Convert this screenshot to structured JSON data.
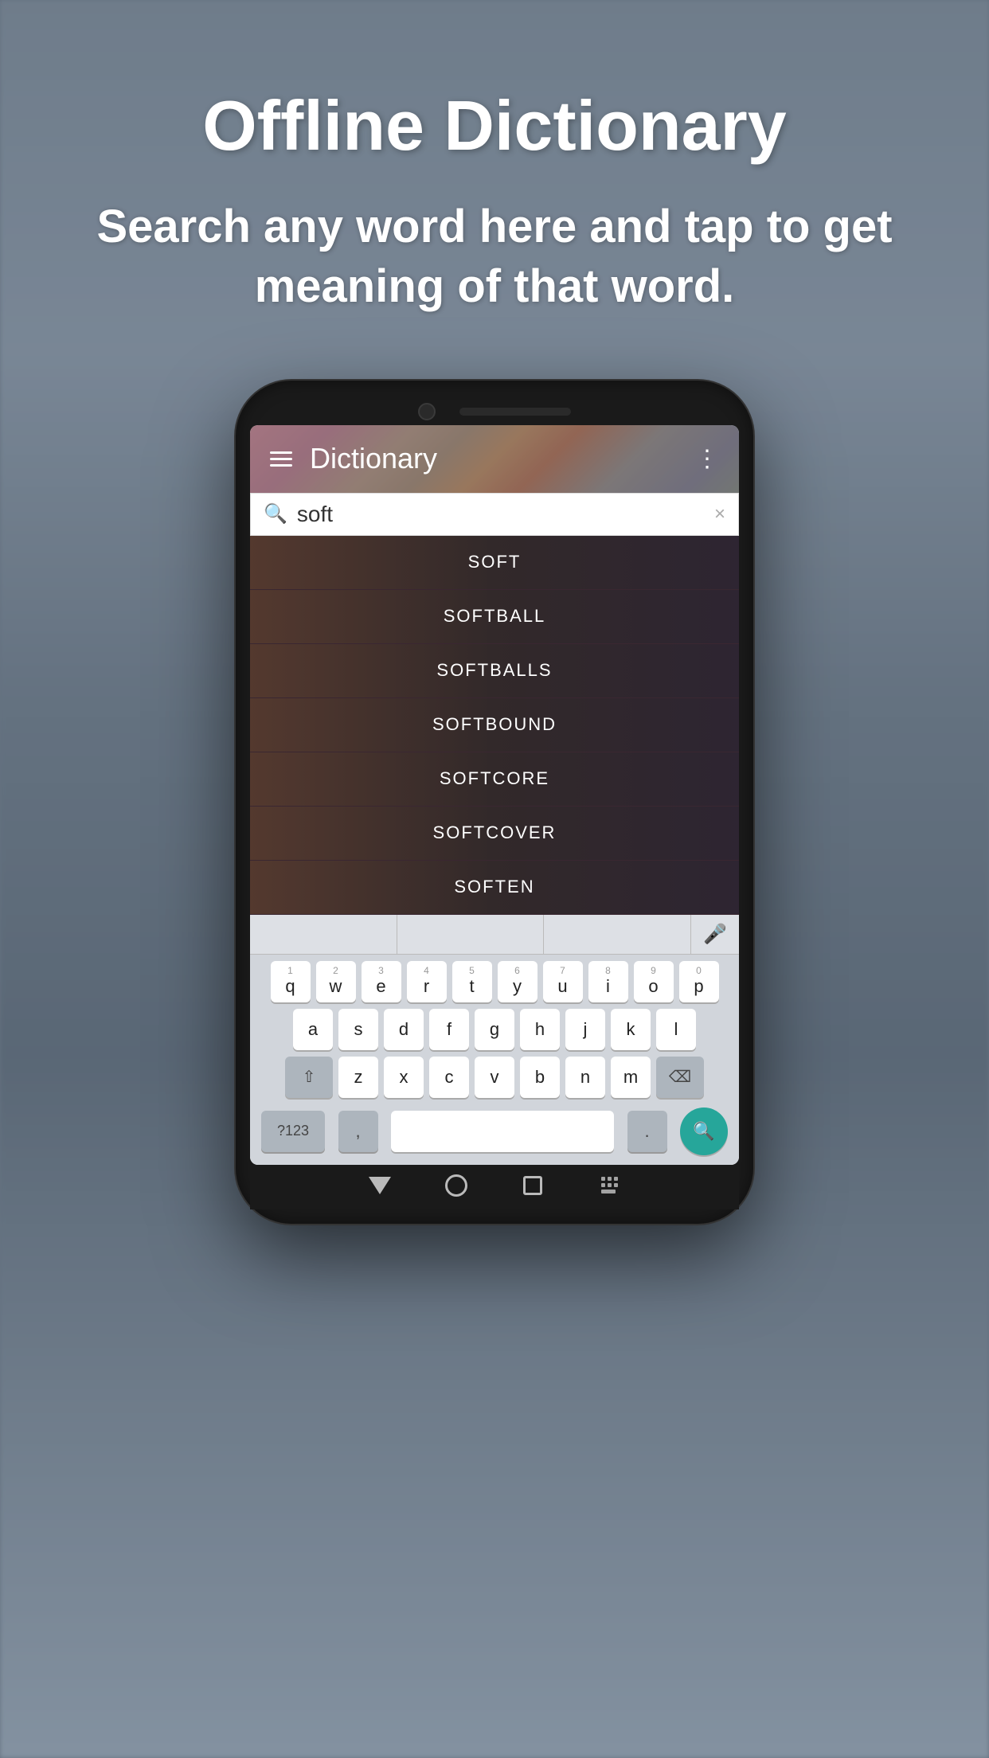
{
  "background": {
    "colors": {
      "primary": "#7a8a9a",
      "overlay": "rgba(60,70,80,0.35)"
    }
  },
  "header": {
    "title": "Offline Dictionary",
    "subtitle": "Search any word here and tap to get meaning of that word."
  },
  "app": {
    "title": "Dictionary",
    "search": {
      "placeholder": "soft",
      "current_value": "soft",
      "clear_label": "×"
    },
    "results": [
      {
        "word": "SOFT"
      },
      {
        "word": "SOFTBALL"
      },
      {
        "word": "SOFTBALLS"
      },
      {
        "word": "SOFTBOUND"
      },
      {
        "word": "SOFTCORE"
      },
      {
        "word": "SOFTCOVER"
      },
      {
        "word": "SOFTEN"
      }
    ]
  },
  "keyboard": {
    "rows": [
      [
        {
          "number": "1",
          "letter": "q"
        },
        {
          "number": "2",
          "letter": "w"
        },
        {
          "number": "3",
          "letter": "e"
        },
        {
          "number": "4",
          "letter": "r"
        },
        {
          "number": "5",
          "letter": "t"
        },
        {
          "number": "6",
          "letter": "y"
        },
        {
          "number": "7",
          "letter": "u"
        },
        {
          "number": "8",
          "letter": "i"
        },
        {
          "number": "9",
          "letter": "o"
        },
        {
          "number": "0",
          "letter": "p"
        }
      ],
      [
        {
          "letter": "a"
        },
        {
          "letter": "s"
        },
        {
          "letter": "d"
        },
        {
          "letter": "f"
        },
        {
          "letter": "g"
        },
        {
          "letter": "h"
        },
        {
          "letter": "j"
        },
        {
          "letter": "k"
        },
        {
          "letter": "l"
        }
      ],
      [
        {
          "letter": "z"
        },
        {
          "letter": "x"
        },
        {
          "letter": "c"
        },
        {
          "letter": "v"
        },
        {
          "letter": "b"
        },
        {
          "letter": "n"
        },
        {
          "letter": "m"
        }
      ]
    ],
    "special_keys": {
      "shift": "⇧",
      "backspace": "⌫",
      "123": "?123",
      "comma": ",",
      "period": ".",
      "search_icon": "🔍"
    }
  },
  "nav": {
    "menu_label": "☰",
    "share_label": "⋮"
  }
}
